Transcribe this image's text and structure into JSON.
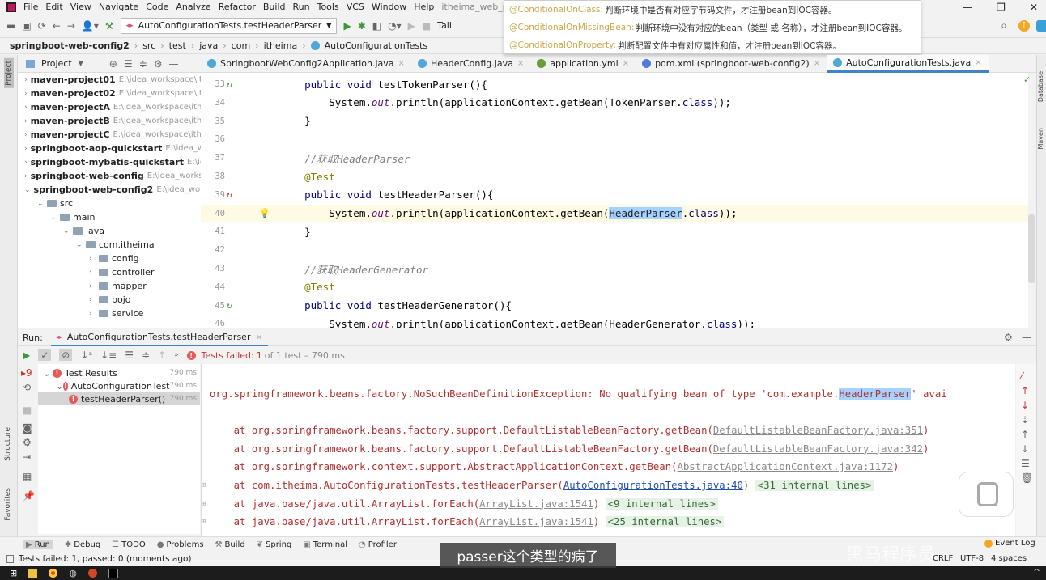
{
  "menu": [
    "File",
    "Edit",
    "View",
    "Navigate",
    "Code",
    "Analyze",
    "Refactor",
    "Build",
    "Run",
    "Tools",
    "VCS",
    "Window",
    "Help"
  ],
  "window_title": "itheima_web_pr",
  "toolbar": {
    "run_config": "AutoConfigurationTests.testHeaderParser",
    "tail": "Tail"
  },
  "breadcrumb": [
    "springboot-web-config2",
    "src",
    "test",
    "java",
    "com",
    "itheima",
    "AutoConfigurationTests"
  ],
  "tooltip": [
    {
      "ann": "@ConditionalOnClass:",
      "text": "判断环境中是否有对应字节码文件，才注册bean到IOC容器。"
    },
    {
      "ann": "@ConditionalOnMissingBean:",
      "text": "判断环境中没有对应的bean（类型 或 名称），才注册bean到IOC容器。"
    },
    {
      "ann": "@ConditionalOnProperty:",
      "text": "判断配置文件中有对应属性和值，才注册bean到IOC容器。"
    }
  ],
  "project": {
    "title": "Project",
    "stripe_label": "Project",
    "items": [
      {
        "name": "maven-project01",
        "path": "E:\\idea_workspace\\ith",
        "level": 0,
        "kind": "module"
      },
      {
        "name": "maven-project02",
        "path": "E:\\idea_workspace\\ith",
        "level": 0,
        "kind": "module"
      },
      {
        "name": "maven-projectA",
        "path": "E:\\idea_workspace\\ith",
        "level": 0,
        "kind": "module"
      },
      {
        "name": "maven-projectB",
        "path": "E:\\idea_workspace\\ith",
        "level": 0,
        "kind": "module"
      },
      {
        "name": "maven-projectC",
        "path": "E:\\idea_workspace\\ith",
        "level": 0,
        "kind": "module"
      },
      {
        "name": "springboot-aop-quickstart",
        "path": "E:\\idea_wor",
        "level": 0,
        "kind": "module"
      },
      {
        "name": "springboot-mybatis-quickstart",
        "path": "E:\\idea",
        "level": 0,
        "kind": "module"
      },
      {
        "name": "springboot-web-config",
        "path": "E:\\idea_worksp",
        "level": 0,
        "kind": "module"
      },
      {
        "name": "springboot-web-config2",
        "path": "E:\\idea_works",
        "level": 0,
        "kind": "module",
        "open": true
      },
      {
        "name": "src",
        "path": "",
        "level": 1,
        "kind": "folder",
        "open": true
      },
      {
        "name": "main",
        "path": "",
        "level": 2,
        "kind": "folder",
        "open": true
      },
      {
        "name": "java",
        "path": "",
        "level": 3,
        "kind": "folder",
        "open": true
      },
      {
        "name": "com.itheima",
        "path": "",
        "level": 4,
        "kind": "folder",
        "open": true
      },
      {
        "name": "config",
        "path": "",
        "level": 5,
        "kind": "folder"
      },
      {
        "name": "controller",
        "path": "",
        "level": 5,
        "kind": "folder"
      },
      {
        "name": "mapper",
        "path": "",
        "level": 5,
        "kind": "folder"
      },
      {
        "name": "pojo",
        "path": "",
        "level": 5,
        "kind": "folder"
      },
      {
        "name": "service",
        "path": "",
        "level": 5,
        "kind": "folder"
      }
    ]
  },
  "tabs": [
    {
      "label": "SpringbootWebConfig2Application.java"
    },
    {
      "label": "HeaderConfig.java"
    },
    {
      "label": "application.yml"
    },
    {
      "label": "pom.xml (springboot-web-config2)"
    },
    {
      "label": "AutoConfigurationTests.java",
      "active": true
    }
  ],
  "code": [
    {
      "n": "33",
      "icon": "run",
      "t": [
        [
          "    ",
          "pl"
        ],
        [
          "public void ",
          "kw"
        ],
        [
          "testTokenParser",
          "fn"
        ],
        [
          "(){",
          "pl"
        ]
      ]
    },
    {
      "n": "34",
      "t": [
        [
          "        System.",
          "pl"
        ],
        [
          "out",
          "it"
        ],
        [
          ".println(applicationContext.getBean(TokenParser.",
          "pl"
        ],
        [
          "class",
          "kw"
        ],
        [
          "));",
          "pl"
        ]
      ]
    },
    {
      "n": "35",
      "t": [
        [
          "    }",
          "pl"
        ]
      ]
    },
    {
      "n": "36",
      "t": []
    },
    {
      "n": "37",
      "t": [
        [
          "    //获取HeaderParser",
          "cm"
        ]
      ]
    },
    {
      "n": "38",
      "t": [
        [
          "    @Test",
          "an"
        ]
      ]
    },
    {
      "n": "39",
      "icon": "fail",
      "t": [
        [
          "    ",
          "pl"
        ],
        [
          "public void ",
          "kw"
        ],
        [
          "testHeaderParser",
          "fn"
        ],
        [
          "(){",
          "pl"
        ]
      ]
    },
    {
      "n": "40",
      "icon": "bulb",
      "cur": true,
      "t": [
        [
          "        System.",
          "pl"
        ],
        [
          "out",
          "it"
        ],
        [
          ".println(applicationContext.getBean(",
          "pl"
        ],
        [
          "HeaderParser",
          "hl"
        ],
        [
          ".",
          "pl"
        ],
        [
          "class",
          "kw"
        ],
        [
          "));",
          "pl"
        ]
      ]
    },
    {
      "n": "41",
      "t": [
        [
          "    }",
          "pl"
        ]
      ]
    },
    {
      "n": "42",
      "t": []
    },
    {
      "n": "43",
      "t": [
        [
          "    //获取HeaderGenerator",
          "cm"
        ]
      ]
    },
    {
      "n": "44",
      "t": [
        [
          "    @Test",
          "an"
        ]
      ]
    },
    {
      "n": "45",
      "icon": "run",
      "t": [
        [
          "    ",
          "pl"
        ],
        [
          "public void ",
          "kw"
        ],
        [
          "testHeaderGenerator",
          "fn"
        ],
        [
          "(){",
          "pl"
        ]
      ]
    },
    {
      "n": "46",
      "t": [
        [
          "        System.",
          "pl"
        ],
        [
          "out",
          "it"
        ],
        [
          ".println(applicationContext.getBean(HeaderGenerator.",
          "pl"
        ],
        [
          "class",
          "kw"
        ],
        [
          "));",
          "pl"
        ]
      ]
    }
  ],
  "run": {
    "label": "Run:",
    "tab": "AutoConfigurationTests.testHeaderParser",
    "summary_prefix": "Tests failed:",
    "summary_count": "1",
    "summary_rest": "of 1 test – 790 ms",
    "tree": [
      {
        "label": "Test Results",
        "time": "790 ms",
        "level": 0
      },
      {
        "label": "AutoConfigurationTest",
        "time": "790 ms",
        "level": 1
      },
      {
        "label": "testHeaderParser()",
        "time": "790 ms",
        "level": 2,
        "selected": true
      }
    ],
    "console": [
      {
        "t": [
          [
            "org.springframework.beans.factory.NoSuchBeanDefinitionException: No qualifying bean of type 'com.example.",
            ""
          ],
          [
            "HeaderParser",
            "hl"
          ],
          [
            "' avai",
            ""
          ]
        ]
      },
      {
        "t": []
      },
      {
        "t": [
          [
            "    at org.springframework.beans.factory.support.DefaultListableBeanFactory.getBean(",
            ""
          ],
          [
            "DefaultListableBeanFactory.java:351",
            "lk"
          ],
          [
            ")",
            ""
          ]
        ]
      },
      {
        "t": [
          [
            "    at org.springframework.beans.factory.support.DefaultListableBeanFactory.getBean(",
            ""
          ],
          [
            "DefaultListableBeanFactory.java:342",
            "lk"
          ],
          [
            ")",
            ""
          ]
        ]
      },
      {
        "t": [
          [
            "    at org.springframework.context.support.AbstractApplicationContext.getBean(",
            ""
          ],
          [
            "AbstractApplicationContext.java:1172",
            "lk"
          ],
          [
            ")",
            ""
          ]
        ]
      },
      {
        "t": [
          [
            "    at com.itheima.AutoConfigurationTests.testHeaderParser(",
            ""
          ],
          [
            "AutoConfigurationTests.java:40",
            "lk2"
          ],
          [
            ") ",
            ""
          ],
          [
            "<31 internal lines>",
            "il"
          ]
        ]
      },
      {
        "t": [
          [
            "    at java.base/java.util.ArrayList.forEach(",
            ""
          ],
          [
            "ArrayList.java:1541",
            "lk"
          ],
          [
            ") ",
            ""
          ],
          [
            "<9 internal lines>",
            "il"
          ]
        ]
      },
      {
        "t": [
          [
            "    at java.base/java.util.ArrayList.forEach(",
            ""
          ],
          [
            "ArrayList.java:1541",
            "lk"
          ],
          [
            ") ",
            ""
          ],
          [
            "<25 internal lines>",
            "il"
          ]
        ]
      }
    ]
  },
  "toolwindows": [
    "Run",
    "Debug",
    "TODO",
    "Problems",
    "Build",
    "Spring",
    "Terminal",
    "Profiler"
  ],
  "left_stripe": [
    "Structure",
    "Favorites"
  ],
  "right_stripe": [
    "Database",
    "Maven"
  ],
  "status": {
    "text": "Tests failed: 1, passed: 0 (moments ago)",
    "event_log": "Event Log",
    "crlf": "CRLF",
    "encoding": "UTF-8",
    "indent": "4 spaces"
  },
  "subtitle": "passer这个类型的病了",
  "watermark": "黑马程序员",
  "colors": {
    "accent": "#4083c9",
    "error": "#e55b5b",
    "console_error": "#b03030"
  }
}
